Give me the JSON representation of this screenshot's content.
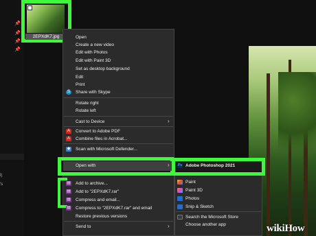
{
  "file": {
    "name": "2EPXdK7.jpg"
  },
  "left_pane": {
    "fragment_1": "l)",
    "fragment_2": "'s"
  },
  "menu": {
    "items": [
      {
        "label": "Open",
        "icon": ""
      },
      {
        "label": "Create a new video",
        "icon": ""
      },
      {
        "label": "Edit with Photos",
        "icon": ""
      },
      {
        "label": "Edit with Paint 3D",
        "icon": ""
      },
      {
        "label": "Set as desktop background",
        "icon": ""
      },
      {
        "label": "Edit",
        "icon": ""
      },
      {
        "label": "Print",
        "icon": ""
      },
      {
        "label": "Share with Skype",
        "icon": "skype-icon"
      },
      {
        "label": "Rotate right",
        "icon": ""
      },
      {
        "label": "Rotate left",
        "icon": ""
      },
      {
        "label": "Cast to Device",
        "icon": ""
      },
      {
        "label": "Convert to Adobe PDF",
        "icon": "adobe-pdf-icon"
      },
      {
        "label": "Combine files in Acrobat...",
        "icon": "acrobat-icon"
      },
      {
        "label": "Scan with Microsoft Defender...",
        "icon": "defender-icon"
      },
      {
        "label": "Open with",
        "icon": ""
      },
      {
        "label": "Add to archive...",
        "icon": "winrar-icon"
      },
      {
        "label": "Add to \"2EPXdK7.rar\"",
        "icon": "winrar-icon"
      },
      {
        "label": "Compress and email...",
        "icon": "winrar-icon"
      },
      {
        "label": "Compress to \"2EPXdK7.rar\" and email",
        "icon": "winrar-icon"
      },
      {
        "label": "Restore previous versions",
        "icon": ""
      },
      {
        "label": "Send to",
        "icon": ""
      }
    ]
  },
  "submenu": {
    "items": [
      {
        "label": "Adobe Photoshop 2021",
        "icon": "photoshop-icon",
        "badge": "Ps"
      },
      {
        "label": "Paint",
        "icon": "paint-icon",
        "badge": ""
      },
      {
        "label": "Paint 3D",
        "icon": "paint3d-icon",
        "badge": ""
      },
      {
        "label": "Photos",
        "icon": "photos-icon",
        "badge": ""
      },
      {
        "label": "Snip & Sketch",
        "icon": "snip-sketch-icon",
        "badge": ""
      },
      {
        "label": "Search the Microsoft Store",
        "icon": "store-icon",
        "badge": ""
      },
      {
        "label": "Choose another app",
        "icon": "",
        "badge": ""
      }
    ]
  },
  "watermark": {
    "wiki": "wiki",
    "how": "How"
  },
  "colors": {
    "highlight": "#3ef83c",
    "menu_bg": "#2b2b2b",
    "page_bg": "#0f0f0f"
  }
}
